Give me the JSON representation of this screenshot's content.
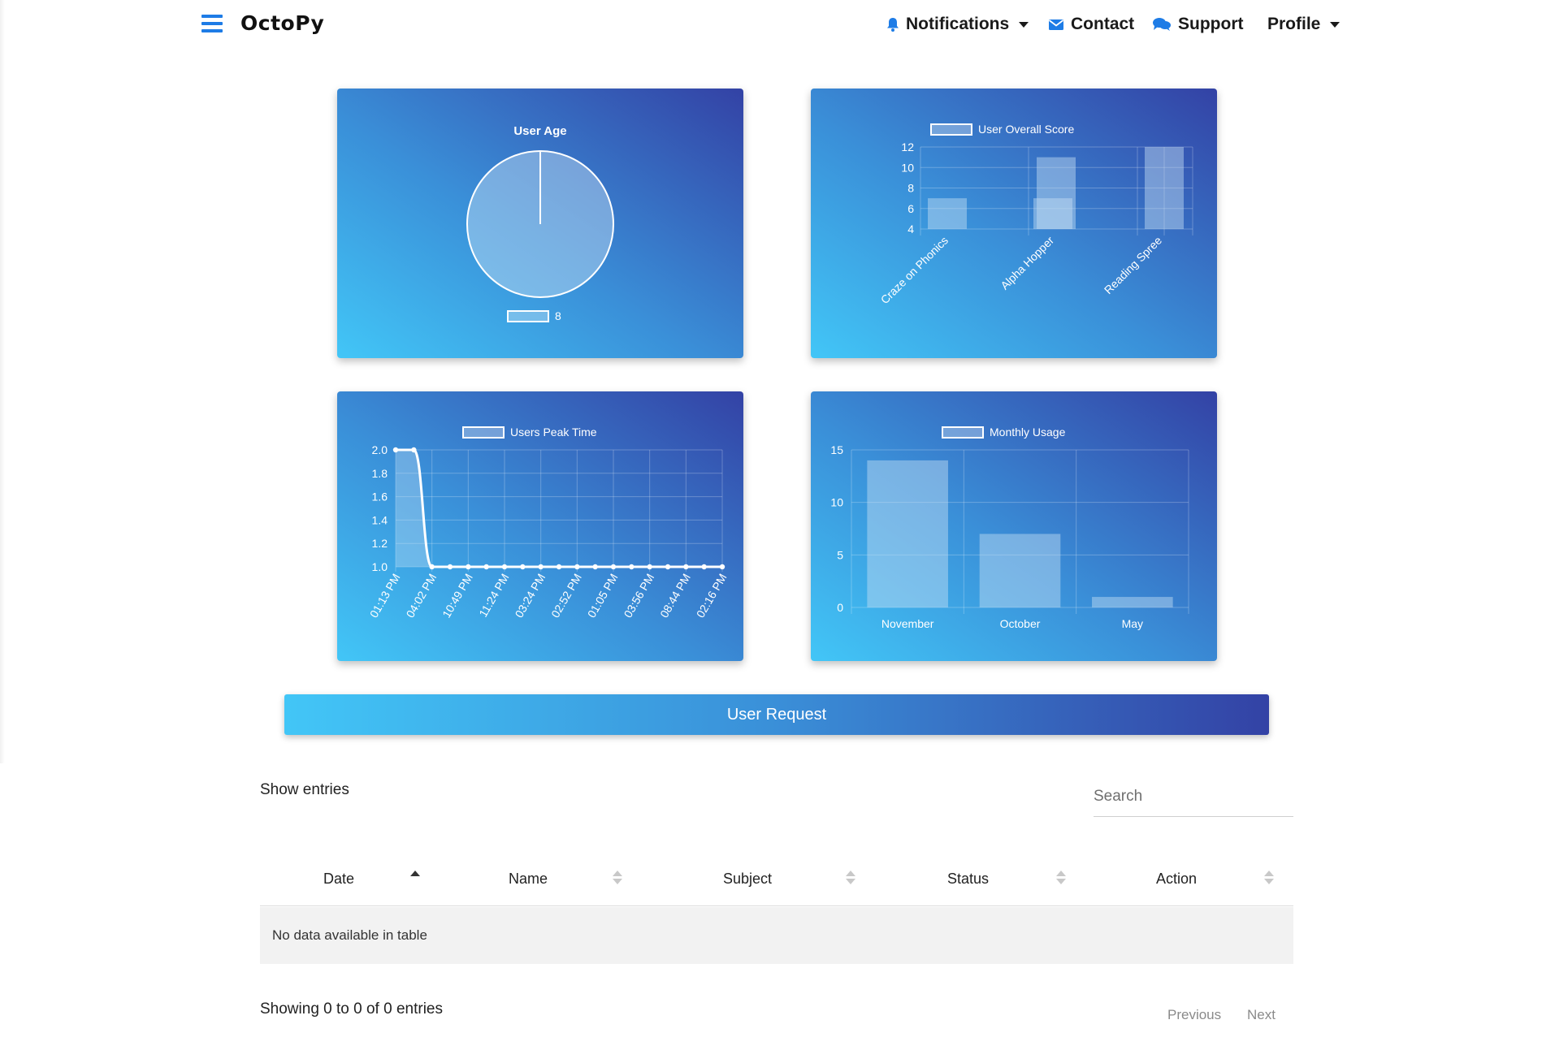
{
  "navbar": {
    "brand": "OctoPy",
    "items": [
      {
        "label": "Notifications",
        "icon": "bell-icon"
      },
      {
        "label": "Contact",
        "icon": "envelope-icon"
      },
      {
        "label": "Support",
        "icon": "comments-icon"
      },
      {
        "label": "Profile",
        "icon": ""
      }
    ],
    "accent_color": "#1e7ce6"
  },
  "chart_data": [
    {
      "type": "pie",
      "title": "User Age",
      "labels": [
        "8"
      ],
      "values": [
        1
      ]
    },
    {
      "type": "bar",
      "title": "",
      "series": [
        {
          "name": "User Overall Score",
          "values": [
            7,
            7,
            11,
            12
          ]
        }
      ],
      "categories": [
        "Craze on Phonics",
        "",
        "Alpha Hopper",
        "Reading Spree"
      ],
      "ylim": [
        4,
        12
      ],
      "yticks": [
        4,
        6,
        8,
        10,
        12
      ]
    },
    {
      "type": "line",
      "title": "",
      "series": [
        {
          "name": "Users Peak Time",
          "values": [
            2,
            2,
            1,
            1,
            1,
            1,
            1,
            1,
            1,
            1,
            1,
            1,
            1,
            1,
            1,
            1,
            1,
            1,
            1
          ]
        }
      ],
      "tick_labels": [
        "01:13 PM",
        "04:02 PM",
        "10:49 PM",
        "11:24 PM",
        "03:24 PM",
        "02:52 PM",
        "01:05 PM",
        "03:56 PM",
        "08:44 PM",
        "02:16 PM"
      ],
      "ylim": [
        1.0,
        2.0
      ],
      "yticks": [
        "1.0",
        "1.2",
        "1.4",
        "1.6",
        "1.8",
        "2.0"
      ]
    },
    {
      "type": "bar",
      "title": "",
      "series": [
        {
          "name": "Monthly Usage",
          "values": [
            14,
            7,
            1
          ]
        }
      ],
      "categories": [
        "November",
        "October",
        "May"
      ],
      "ylim": [
        0,
        15
      ],
      "yticks": [
        0,
        5,
        10,
        15
      ]
    }
  ],
  "user_request": {
    "label": "User Request"
  },
  "table": {
    "show_entries": "Show entries",
    "search_placeholder": "Search",
    "columns": [
      "Date",
      "Name",
      "Subject",
      "Status",
      "Action"
    ],
    "empty_message": "No data available in table",
    "info": "Showing 0 to 0 of 0 entries",
    "previous": "Previous",
    "next": "Next"
  }
}
